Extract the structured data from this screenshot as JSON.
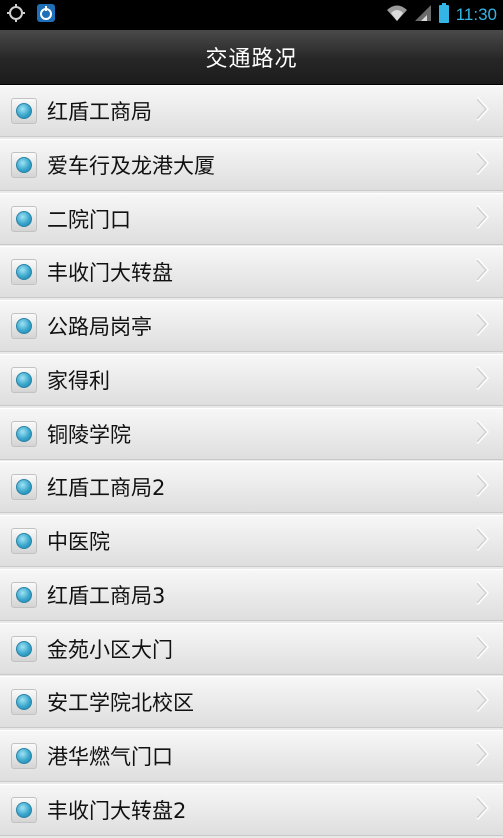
{
  "status_bar": {
    "time": "11:30",
    "icons": [
      "sync-icon",
      "app-notification-icon",
      "wifi-icon",
      "signal-icon",
      "battery-icon"
    ],
    "accent_color": "#33b5e5"
  },
  "header": {
    "title": "交通路况"
  },
  "list": {
    "items": [
      {
        "label": "红盾工商局"
      },
      {
        "label": "爱车行及龙港大厦"
      },
      {
        "label": "二院门口"
      },
      {
        "label": "丰收门大转盘"
      },
      {
        "label": "公路局岗亭"
      },
      {
        "label": "家得利"
      },
      {
        "label": "铜陵学院"
      },
      {
        "label": "红盾工商局2"
      },
      {
        "label": "中医院"
      },
      {
        "label": "红盾工商局3"
      },
      {
        "label": "金苑小区大门"
      },
      {
        "label": "安工学院北校区"
      },
      {
        "label": "港华燃气门口"
      },
      {
        "label": "丰收门大转盘2"
      }
    ],
    "item_icon": "blue-dot-icon",
    "trailing_icon": "chevron-right-icon"
  }
}
